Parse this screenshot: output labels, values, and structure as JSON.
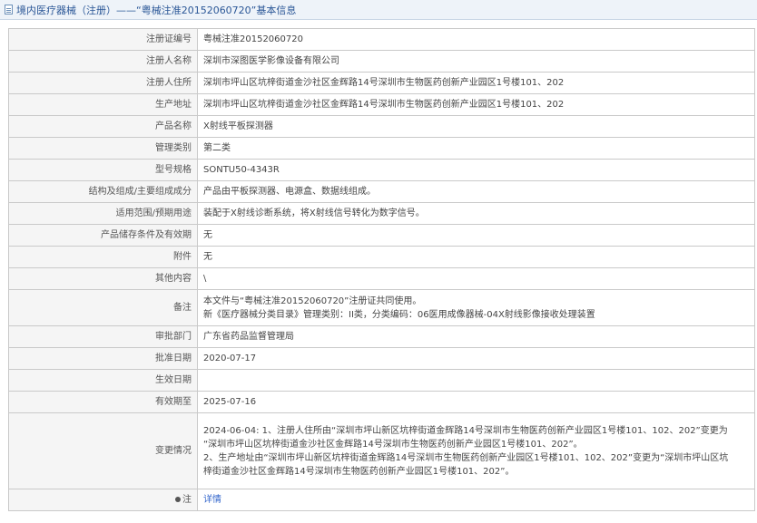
{
  "header": {
    "title": "境内医疗器械（注册）——“粤械注准20152060720”基本信息"
  },
  "rows": [
    {
      "label": "注册证编号",
      "value": "粤械注准20152060720"
    },
    {
      "label": "注册人名称",
      "value": "深圳市深图医学影像设备有限公司"
    },
    {
      "label": "注册人住所",
      "value": "深圳市坪山区坑梓街道金沙社区金辉路14号深圳市生物医药创新产业园区1号楼101、202"
    },
    {
      "label": "生产地址",
      "value": "深圳市坪山区坑梓街道金沙社区金辉路14号深圳市生物医药创新产业园区1号楼101、202"
    },
    {
      "label": "产品名称",
      "value": "X射线平板探测器"
    },
    {
      "label": "管理类别",
      "value": "第二类"
    },
    {
      "label": "型号规格",
      "value": "SONTU50-4343R"
    },
    {
      "label": "结构及组成/主要组成成分",
      "value": "产品由平板探测器、电源盒、数据线组成。"
    },
    {
      "label": "适用范围/预期用途",
      "value": "装配于X射线诊断系统，将X射线信号转化为数字信号。"
    },
    {
      "label": "产品储存条件及有效期",
      "value": "无"
    },
    {
      "label": "附件",
      "value": "无"
    },
    {
      "label": "其他内容",
      "value": "\\"
    },
    {
      "label": "备注",
      "lines": [
        "本文件与“粤械注准20152060720”注册证共同使用。",
        "新《医疗器械分类目录》管理类别：II类，分类编码：06医用成像器械-04X射线影像接收处理装置"
      ]
    },
    {
      "label": "审批部门",
      "value": "广东省药品监督管理局"
    },
    {
      "label": "批准日期",
      "value": "2020-07-17"
    },
    {
      "label": "生效日期",
      "value": ""
    },
    {
      "label": "有效期至",
      "value": "2025-07-16"
    },
    {
      "label": "变更情况",
      "lines": [
        "2024-06-04: 1、注册人住所由“深圳市坪山新区坑梓街道金辉路14号深圳市生物医药创新产业园区1号楼101、102、202”变更为",
        "“深圳市坪山区坑梓街道金沙社区金辉路14号深圳市生物医药创新产业园区1号楼101、202”。",
        "2、生产地址由“深圳市坪山新区坑梓街道金辉路14号深圳市生物医药创新产业园区1号楼101、102、202”变更为“深圳市坪山区坑",
        "梓街道金沙社区金辉路14号深圳市生物医药创新产业园区1号楼101、202”。"
      ]
    }
  ],
  "footer": {
    "label": "注",
    "link": "详情"
  }
}
